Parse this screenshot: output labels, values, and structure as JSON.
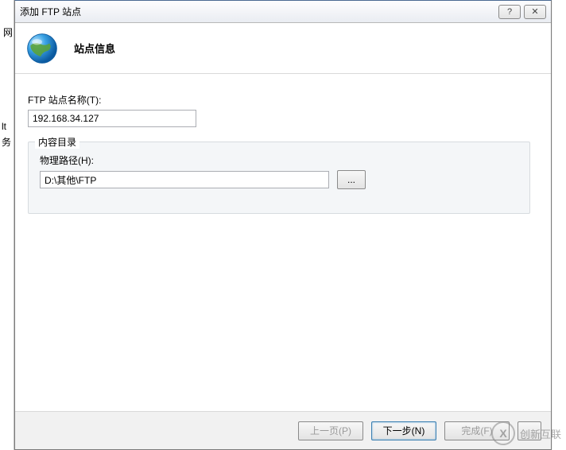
{
  "left_panel": {
    "label1": "网",
    "label2": "lt",
    "label3": "务"
  },
  "dialog": {
    "title": "添加 FTP 站点",
    "header_title": "站点信息",
    "site_name_label": "FTP 站点名称(T):",
    "site_name_value": "192.168.34.127",
    "content_dir_legend": "内容目录",
    "physical_path_label": "物理路径(H):",
    "physical_path_value": "D:\\其他\\FTP",
    "browse_label": "...",
    "buttons": {
      "prev": "上一页(P)",
      "next": "下一步(N)",
      "finish": "完成(F)",
      "cancel": ""
    },
    "titlebar_help": "?",
    "titlebar_close": "✕"
  },
  "watermark": {
    "icon_text": "X",
    "text": "创新互联"
  }
}
